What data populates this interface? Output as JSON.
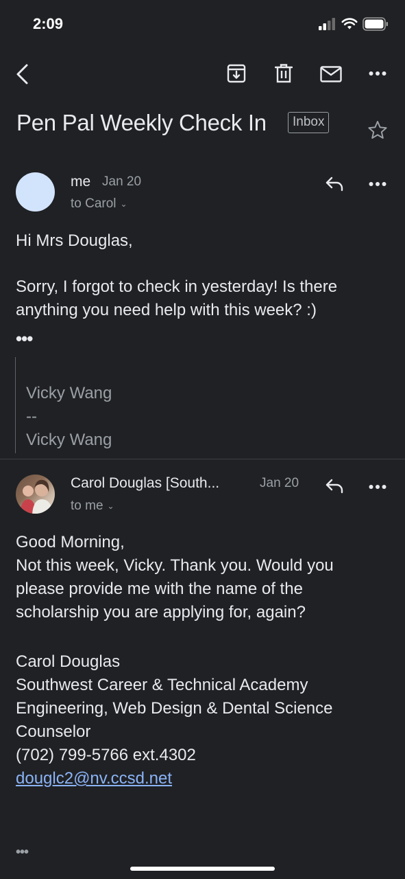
{
  "status_bar": {
    "time": "2:09"
  },
  "toolbar": {
    "back_icon": "back-arrow-icon",
    "archive_icon": "archive-icon",
    "delete_icon": "trash-icon",
    "unread_icon": "mail-icon",
    "more_icon": "more-dots-icon"
  },
  "thread": {
    "subject": "Pen Pal Weekly Check In",
    "label": "Inbox"
  },
  "messages": [
    {
      "sender": "me",
      "date": "Jan 20",
      "recipient": "to Carol",
      "greeting": "Hi Mrs Douglas,",
      "body_line1": "Sorry, I forgot to check in yesterday! Is there",
      "body_line2": "anything you need help with this week? :)",
      "trimmed": "•••",
      "quoted_line1": "Vicky Wang",
      "quoted_line2": "--",
      "quoted_line3": "Vicky Wang"
    },
    {
      "sender": "Carol Douglas [South...",
      "date": "Jan 20",
      "recipient": "to me",
      "body_lines": [
        "Good Morning,",
        "Not this week, Vicky. Thank you. Would you",
        "please provide me with the name of the",
        "scholarship you are applying for, again?"
      ],
      "signature_lines": [
        "Carol Douglas",
        "Southwest Career & Technical Academy",
        "Engineering, Web Design & Dental Science",
        "Counselor",
        "(702) 799-5766 ext.4302"
      ],
      "email_link": "douglc2@nv.ccsd.net",
      "trimmed": "•••"
    }
  ],
  "colors": {
    "background": "#202124",
    "text": "#e8eaed",
    "secondary_text": "#9aa0a6",
    "link": "#8ab4f8"
  }
}
